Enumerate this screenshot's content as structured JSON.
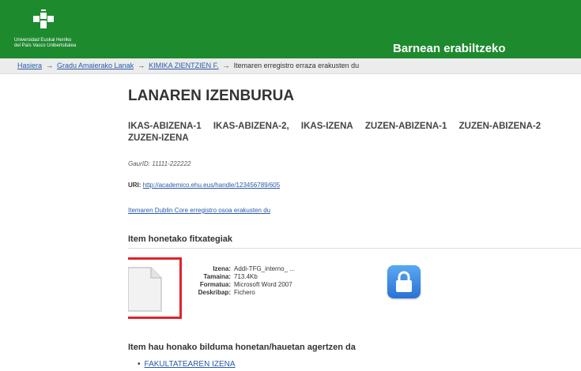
{
  "header": {
    "logo_line1": "Universidad     Euskal Herriko",
    "logo_line2": "del País Vasco    Unibertsitatea",
    "title": "Barnean erabiltzeko"
  },
  "breadcrumb": {
    "items": [
      "Hasiera",
      "Gradu Amaierako Lanak",
      "KIMIKA ZIENTZIEN F."
    ],
    "separator": "→",
    "current": "Itemaren erregistro erraza erakusten du"
  },
  "item": {
    "title": "LANAREN IZENBURUA",
    "authors_line1": [
      "IKAS-ABIZENA-1",
      "IKAS-ABIZENA-2,",
      "IKAS-IZENA",
      "ZUZEN-ABIZENA-1",
      "ZUZEN-ABIZENA-2"
    ],
    "authors_line2": "ZUZEN-IZENA",
    "gaurid": "GaurID: 11111-222222",
    "uri_label": "URI:",
    "uri_value": "http://academico.ehu.eus/handle/123456789/605",
    "dublin_core_link": "Itemaren Dublin Core erregistro osoa erakusten du"
  },
  "files": {
    "heading": "Item honetako fitxategiak",
    "meta": [
      {
        "key": "Izena:",
        "value": "Addi-TFG_interno_ ..."
      },
      {
        "key": "Tamaina:",
        "value": "713.4Kb"
      },
      {
        "key": "Formatua:",
        "value": "Microsoft Word 2007"
      },
      {
        "key": "Deskribap:",
        "value": "Fichero"
      }
    ],
    "doc_icon": "document-icon",
    "lock_icon": "lock-icon",
    "highlight_color": "#e0232b"
  },
  "collections": {
    "heading": "Item hau honako bilduma honetan/hauetan agertzen da",
    "items": [
      "FAKULTATEAREN IZENA"
    ]
  },
  "colors": {
    "header_green": "#1e8a2e",
    "link_blue": "#2a5aa8",
    "lock_blue": "#2a72d8"
  }
}
